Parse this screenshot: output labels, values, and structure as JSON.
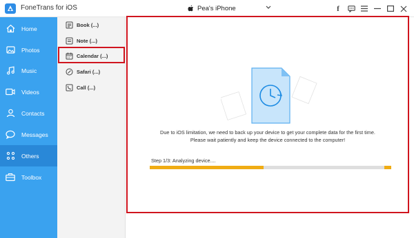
{
  "app": {
    "title": "FoneTrans for iOS"
  },
  "device": {
    "name": "Pea's iPhone"
  },
  "window_controls": [
    {
      "name": "facebook-icon",
      "glyph": "f"
    },
    {
      "name": "chat-icon",
      "glyph": ""
    },
    {
      "name": "menu-icon",
      "glyph": "≡"
    },
    {
      "name": "minimize-icon",
      "glyph": "—"
    },
    {
      "name": "maximize-icon",
      "glyph": "☐"
    },
    {
      "name": "close-icon",
      "glyph": "✕"
    }
  ],
  "nav": {
    "items": [
      {
        "label": "Home",
        "icon": "home-icon"
      },
      {
        "label": "Photos",
        "icon": "photos-icon"
      },
      {
        "label": "Music",
        "icon": "music-icon"
      },
      {
        "label": "Videos",
        "icon": "videos-icon"
      },
      {
        "label": "Contacts",
        "icon": "contacts-icon"
      },
      {
        "label": "Messages",
        "icon": "messages-icon"
      },
      {
        "label": "Others",
        "icon": "others-icon",
        "active": true
      },
      {
        "label": "Toolbox",
        "icon": "toolbox-icon"
      }
    ]
  },
  "sublist": {
    "items": [
      {
        "label": "Book (...)",
        "icon": "book-icon"
      },
      {
        "label": "Note (...)",
        "icon": "note-icon"
      },
      {
        "label": "Calendar (...)",
        "icon": "calendar-icon",
        "highlighted": true
      },
      {
        "label": "Safari (...)",
        "icon": "safari-icon"
      },
      {
        "label": "Call (...)",
        "icon": "call-icon"
      }
    ]
  },
  "main": {
    "message_line1": "Due to iOS limitation, we need to back up your device to get your complete data for the first time.",
    "message_line2": "Please wait patiently and keep the device connected to the computer!",
    "step_text": "Step 1/3: Analyzing device....",
    "progress_fraction": 0.47
  },
  "colors": {
    "accent": "#3aa2ef",
    "nav_active": "#2988d8",
    "highlight_border": "#d0141e",
    "progress": "#f0ac14"
  }
}
